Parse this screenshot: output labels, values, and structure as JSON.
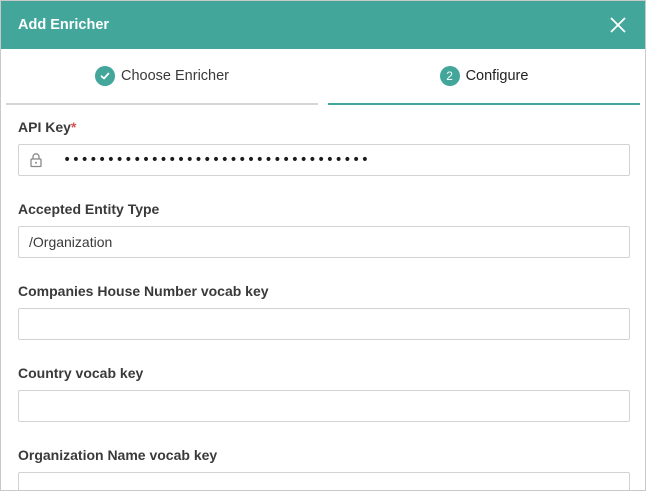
{
  "dialog": {
    "title": "Add Enricher",
    "close_icon": "close-icon"
  },
  "steps": [
    {
      "label": "Choose Enricher",
      "status": "completed",
      "icon": "check-icon"
    },
    {
      "label": "Configure",
      "status": "active",
      "number": "2"
    }
  ],
  "form": {
    "api_key": {
      "label": "API Key",
      "required_mark": "*",
      "value_masked": "•••••••••••••••••••••••••••••••••••",
      "icon": "lock-icon"
    },
    "accepted_entity_type": {
      "label": "Accepted Entity Type",
      "value": "/Organization"
    },
    "companies_house_number_vocab_key": {
      "label": "Companies House Number vocab key",
      "value": ""
    },
    "country_vocab_key": {
      "label": "Country vocab key",
      "value": ""
    },
    "organization_name_vocab_key": {
      "label": "Organization Name vocab key",
      "value": ""
    }
  },
  "colors": {
    "accent": "#42a69a",
    "required": "#d9534f"
  }
}
